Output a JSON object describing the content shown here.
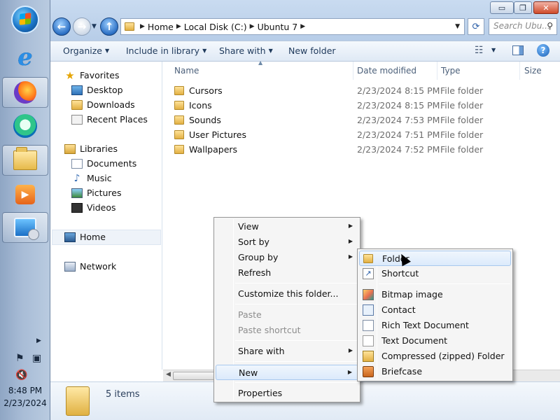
{
  "taskbar": {
    "buttons": [
      "start-orb",
      "internet-explorer",
      "firefox",
      "edge",
      "file-explorer",
      "media-player",
      "remote-desktop"
    ],
    "clock_time": "8:48 PM",
    "clock_date": "2/23/2024"
  },
  "explorer": {
    "caption_buttons": {
      "minimize": "▭",
      "maximize": "❐",
      "close": "✕"
    },
    "address": {
      "crumbs": [
        "Home",
        "Local Disk (C:)",
        "Ubuntu 7"
      ]
    },
    "search_placeholder": "Search Ubu...",
    "toolbar": {
      "organize": "Organize",
      "include_in_library": "Include in library",
      "share_with": "Share with",
      "new_folder": "New folder"
    },
    "nav": {
      "favorites": "Favorites",
      "desktop": "Desktop",
      "downloads": "Downloads",
      "recent_places": "Recent Places",
      "libraries": "Libraries",
      "documents": "Documents",
      "music": "Music",
      "pictures": "Pictures",
      "videos": "Videos",
      "home": "Home",
      "network": "Network"
    },
    "columns": {
      "name": "Name",
      "date_modified": "Date modified",
      "type": "Type",
      "size": "Size"
    },
    "files": [
      {
        "name": "Cursors",
        "date": "2/23/2024 8:15 PM",
        "type": "File folder"
      },
      {
        "name": "Icons",
        "date": "2/23/2024 8:15 PM",
        "type": "File folder"
      },
      {
        "name": "Sounds",
        "date": "2/23/2024 7:53 PM",
        "type": "File folder"
      },
      {
        "name": "User Pictures",
        "date": "2/23/2024 7:51 PM",
        "type": "File folder"
      },
      {
        "name": "Wallpapers",
        "date": "2/23/2024 7:52 PM",
        "type": "File folder"
      }
    ],
    "details": {
      "item_count": "5 items"
    }
  },
  "context_menu": {
    "view": "View",
    "sort_by": "Sort by",
    "group_by": "Group by",
    "refresh": "Refresh",
    "customize": "Customize this folder...",
    "paste": "Paste",
    "paste_shortcut": "Paste shortcut",
    "share_with": "Share with",
    "new": "New",
    "properties": "Properties"
  },
  "new_submenu": {
    "folder": "Folder",
    "shortcut": "Shortcut",
    "bitmap": "Bitmap image",
    "contact": "Contact",
    "rtf": "Rich Text Document",
    "text": "Text Document",
    "zip": "Compressed (zipped) Folder",
    "briefcase": "Briefcase"
  }
}
